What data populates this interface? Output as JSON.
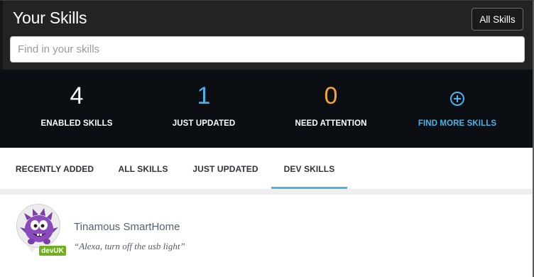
{
  "header": {
    "title": "Your Skills",
    "all_skills_button": "All Skills",
    "search_placeholder": "Find in your skills"
  },
  "stats": [
    {
      "value": "4",
      "label": "ENABLED SKILLS",
      "color": "#ffffff"
    },
    {
      "value": "1",
      "label": "JUST UPDATED",
      "color": "#4bb3e6"
    },
    {
      "value": "0",
      "label": "NEED ATTENTION",
      "color": "#f3a33b"
    }
  ],
  "find_more": {
    "label": "FIND MORE SKILLS",
    "icon": "plus-circle-icon",
    "color": "#4bb3e6"
  },
  "tabs": [
    {
      "label": "RECENTLY ADDED",
      "active": false
    },
    {
      "label": "ALL SKILLS",
      "active": false
    },
    {
      "label": "JUST UPDATED",
      "active": false
    },
    {
      "label": "DEV SKILLS",
      "active": true
    }
  ],
  "skills": [
    {
      "name": "Tinamous SmartHome",
      "phrase": "“Alexa, turn off the usb light”",
      "badge": "devUK",
      "icon": "purple-monster-avatar-icon"
    }
  ],
  "colors": {
    "accent": "#4bb3e6",
    "header_bg": "#232325",
    "stats_bg": "#0b0e13",
    "badge": "#6faf1f",
    "attention": "#f3a33b"
  }
}
